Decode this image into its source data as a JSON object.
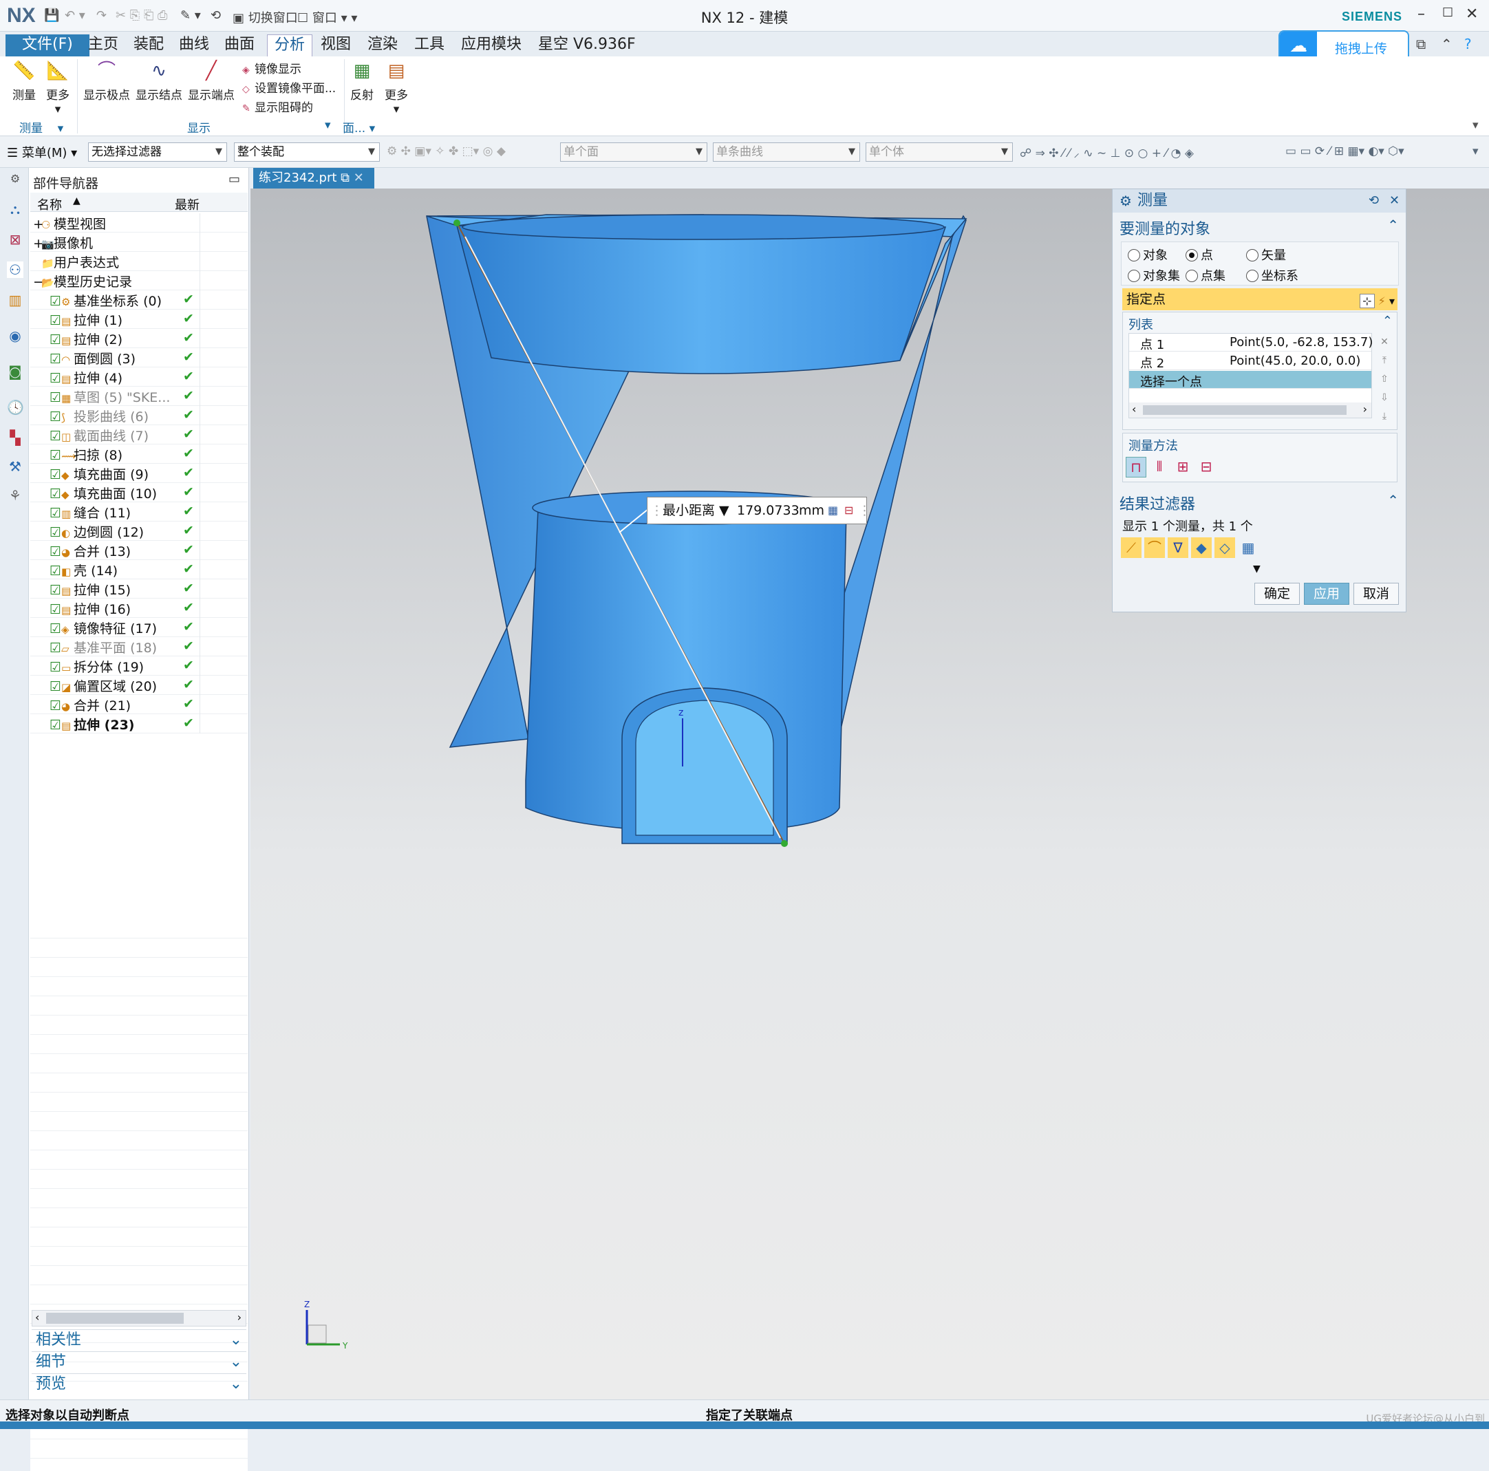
{
  "titlebar": {
    "logo": "NX",
    "switch_window": "切换窗口",
    "window": "窗口",
    "title": "NX 12 - 建模",
    "brand": "SIEMENS",
    "minimize": "–",
    "maximize": "☐",
    "close": "✕"
  },
  "menubar": {
    "tabs": [
      "文件(F)",
      "主页",
      "装配",
      "曲线",
      "曲面",
      "分析",
      "视图",
      "渲染",
      "工具",
      "应用模块",
      "星空 V6.936F"
    ],
    "active": "分析"
  },
  "upload": {
    "label": "拖拽上传"
  },
  "ribbon": {
    "measure": "测量",
    "more": "更多",
    "show_poles": "显示极点",
    "show_knots": "显示结点",
    "show_ends": "显示端点",
    "mirror_display": "镜像显示",
    "set_mirror_plane": "设置镜像平面...",
    "show_blockage": "显示阻碍的",
    "reflect": "反射",
    "more2": "更多",
    "group_measure": "测量",
    "group_display": "显示",
    "group_face": "面..."
  },
  "toolbar": {
    "menu": "菜单(M)",
    "filter": "无选择过滤器",
    "assembly": "整个装配",
    "face": "单个面",
    "curve": "单条曲线",
    "body": "单个体"
  },
  "navigator": {
    "title": "部件导航器",
    "col_name": "名称",
    "col_new": "最新",
    "rows": [
      {
        "label": "模型视图",
        "ind": "+",
        "dim": false,
        "bold": false,
        "check": ""
      },
      {
        "label": "摄像机",
        "ind": "+",
        "dim": false,
        "bold": false,
        "check": ""
      },
      {
        "label": "用户表达式",
        "ind": "",
        "dim": false,
        "bold": false,
        "check": ""
      },
      {
        "label": "模型历史记录",
        "ind": "−",
        "dim": false,
        "bold": false,
        "check": ""
      },
      {
        "label": "基准坐标系 (0)",
        "ind": "",
        "dim": false,
        "bold": false,
        "check": "✔"
      },
      {
        "label": "拉伸 (1)",
        "ind": "",
        "dim": false,
        "bold": false,
        "check": "✔"
      },
      {
        "label": "拉伸 (2)",
        "ind": "",
        "dim": false,
        "bold": false,
        "check": "✔"
      },
      {
        "label": "面倒圆 (3)",
        "ind": "",
        "dim": false,
        "bold": false,
        "check": "✔"
      },
      {
        "label": "拉伸 (4)",
        "ind": "",
        "dim": false,
        "bold": false,
        "check": "✔"
      },
      {
        "label": "草图 (5) \"SKE...",
        "ind": "",
        "dim": true,
        "bold": false,
        "check": "✔"
      },
      {
        "label": "投影曲线 (6)",
        "ind": "",
        "dim": true,
        "bold": false,
        "check": "✔"
      },
      {
        "label": "截面曲线 (7)",
        "ind": "",
        "dim": true,
        "bold": false,
        "check": "✔"
      },
      {
        "label": "扫掠 (8)",
        "ind": "",
        "dim": false,
        "bold": false,
        "check": "✔"
      },
      {
        "label": "填充曲面 (9)",
        "ind": "",
        "dim": false,
        "bold": false,
        "check": "✔"
      },
      {
        "label": "填充曲面 (10)",
        "ind": "",
        "dim": false,
        "bold": false,
        "check": "✔"
      },
      {
        "label": "缝合 (11)",
        "ind": "",
        "dim": false,
        "bold": false,
        "check": "✔"
      },
      {
        "label": "边倒圆 (12)",
        "ind": "",
        "dim": false,
        "bold": false,
        "check": "✔"
      },
      {
        "label": "合并 (13)",
        "ind": "",
        "dim": false,
        "bold": false,
        "check": "✔"
      },
      {
        "label": "壳 (14)",
        "ind": "",
        "dim": false,
        "bold": false,
        "check": "✔"
      },
      {
        "label": "拉伸 (15)",
        "ind": "",
        "dim": false,
        "bold": false,
        "check": "✔"
      },
      {
        "label": "拉伸 (16)",
        "ind": "",
        "dim": false,
        "bold": false,
        "check": "✔"
      },
      {
        "label": "镜像特征 (17)",
        "ind": "",
        "dim": false,
        "bold": false,
        "check": "✔"
      },
      {
        "label": "基准平面 (18)",
        "ind": "",
        "dim": true,
        "bold": false,
        "check": "✔"
      },
      {
        "label": "拆分体 (19)",
        "ind": "",
        "dim": false,
        "bold": false,
        "check": "✔"
      },
      {
        "label": "偏置区域 (20)",
        "ind": "",
        "dim": false,
        "bold": false,
        "check": "✔"
      },
      {
        "label": "合并 (21)",
        "ind": "",
        "dim": false,
        "bold": false,
        "check": "✔"
      },
      {
        "label": "拉伸 (23)",
        "ind": "",
        "dim": false,
        "bold": true,
        "check": "✔"
      }
    ],
    "sections": [
      "相关性",
      "细节",
      "预览"
    ]
  },
  "document": {
    "tab": "练习2342.prt"
  },
  "measure_dialog": {
    "title": "测量",
    "section_objects": "要测量的对象",
    "radios": [
      {
        "label": "对象",
        "on": false
      },
      {
        "label": "点",
        "on": true
      },
      {
        "label": "矢量",
        "on": false
      },
      {
        "label": "对象集",
        "on": false
      },
      {
        "label": "点集",
        "on": false
      },
      {
        "label": "坐标系",
        "on": false
      }
    ],
    "specify_point": "指定点",
    "list_label": "列表",
    "list": [
      {
        "name": "点 1",
        "value": "Point(5.0, -62.8, 153.7)"
      },
      {
        "name": "点 2",
        "value": "Point(45.0, 20.0, 0.0)"
      },
      {
        "name": "选择一个点",
        "value": ""
      }
    ],
    "method_label": "测量方法",
    "section_filter": "结果过滤器",
    "filter_text": "显示 1 个测量，共 1 个",
    "ok": "确定",
    "apply": "应用",
    "cancel": "取消"
  },
  "readout": {
    "type": "最小距离",
    "value": "179.0733",
    "unit": "mm"
  },
  "triad": {
    "z": "Z",
    "y": "Y"
  },
  "status": {
    "left": "选择对象以自动判断点",
    "middle": "指定了关联端点",
    "watermark": "UG爱好者论坛@从小白到"
  },
  "colors": {
    "accent": "#2f7fb8",
    "model": "#4da3ec",
    "spec_highlight": "#ffd86b",
    "selected_row": "#8ac4d8"
  }
}
